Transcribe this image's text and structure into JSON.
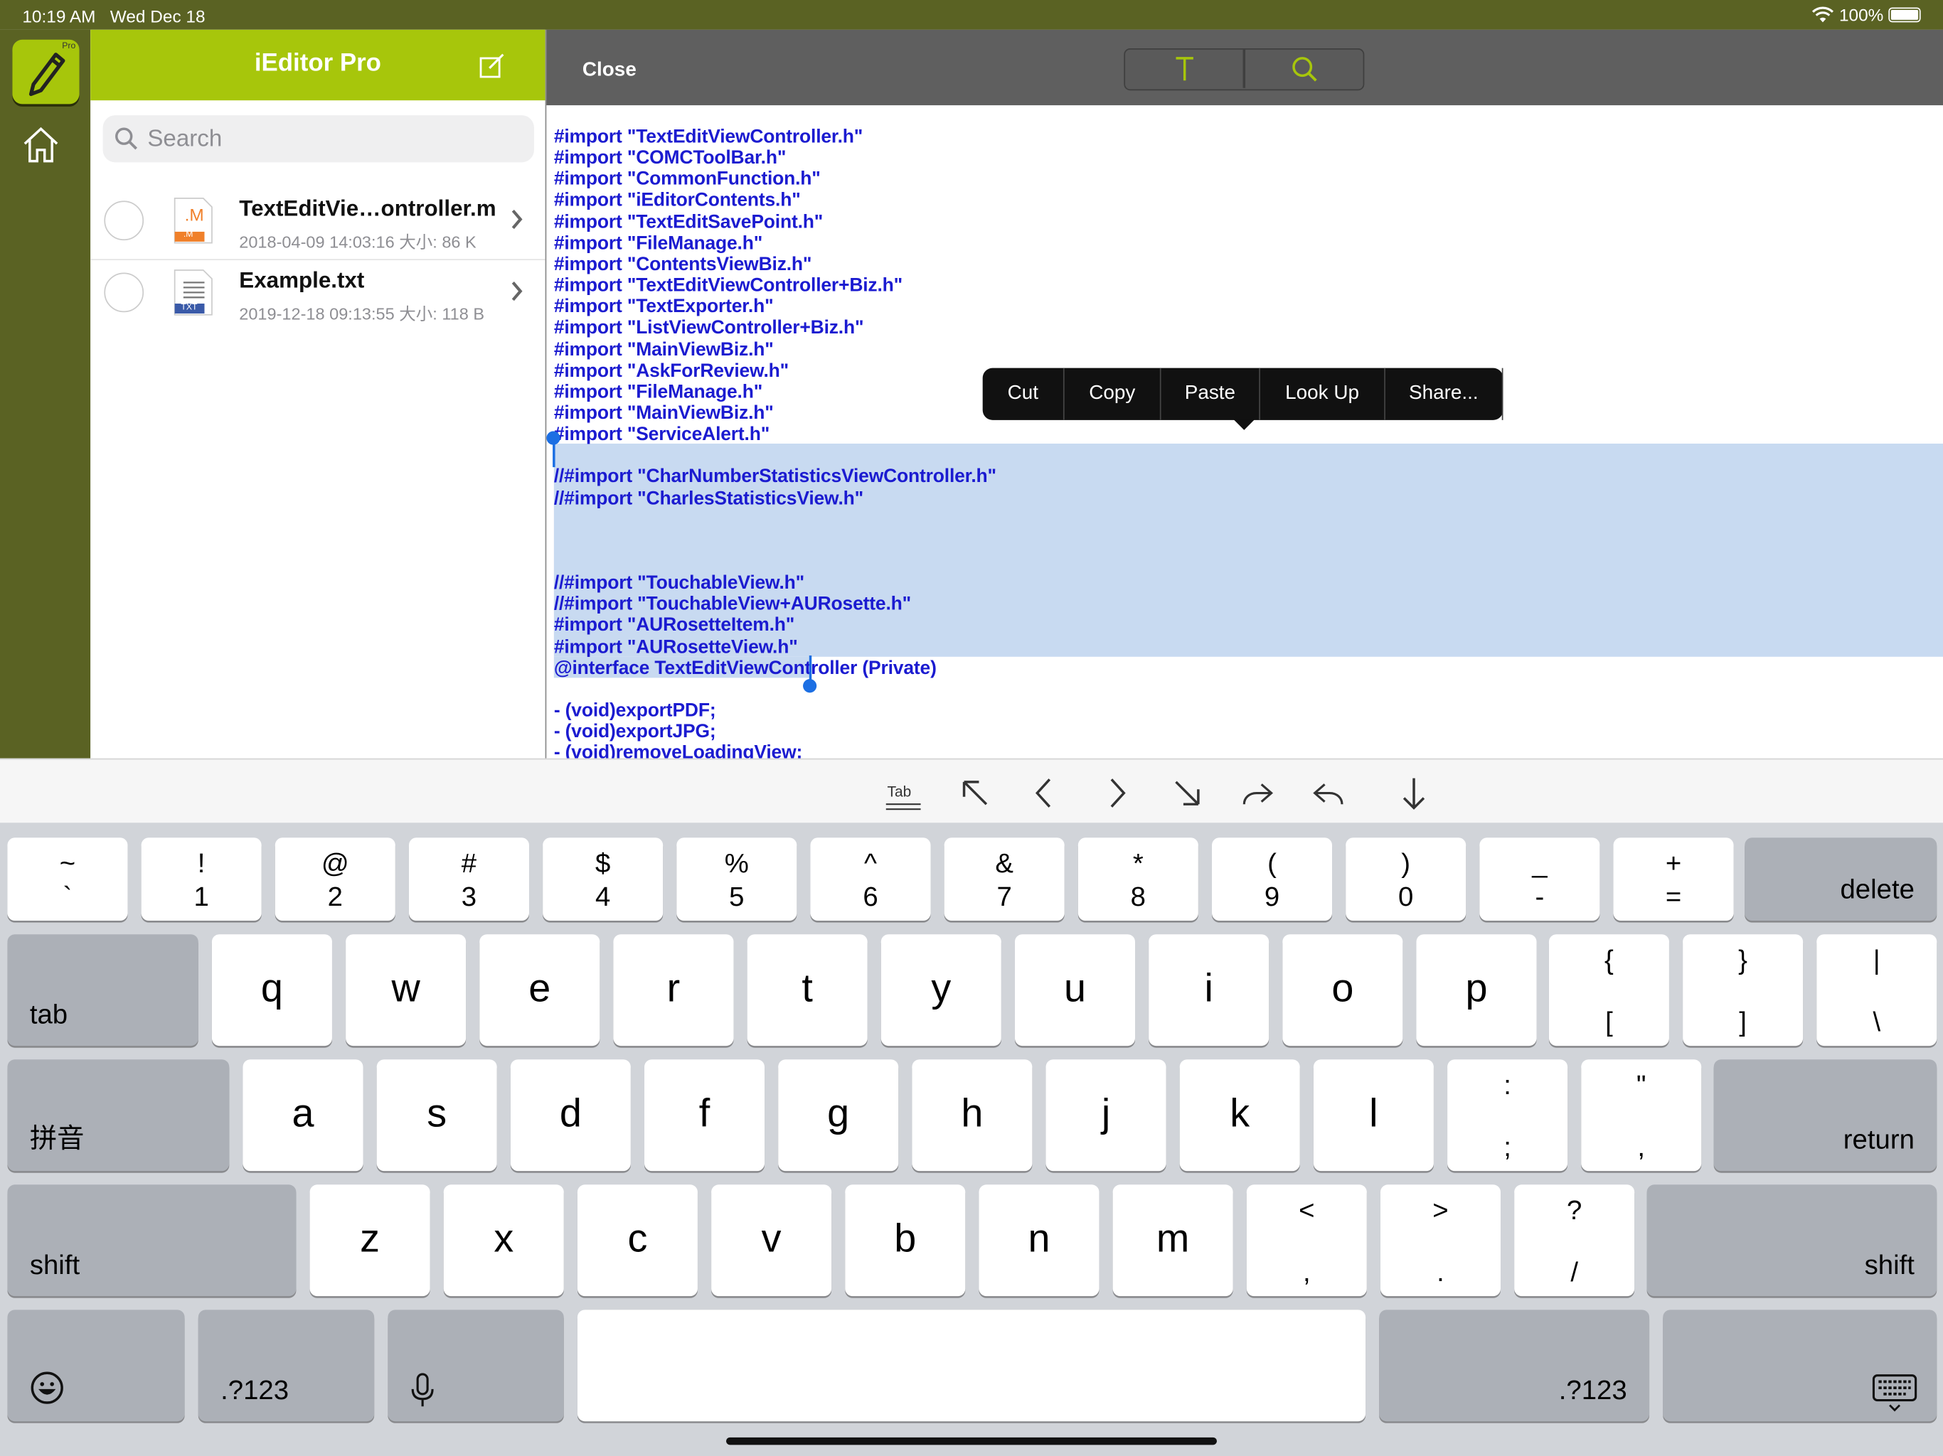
{
  "status": {
    "time": "10:19 AM",
    "date": "Wed Dec 18",
    "battery": "100%"
  },
  "sidebar": {
    "title": "iEditor Pro",
    "search_placeholder": "Search",
    "app_badge": "Pro"
  },
  "files": [
    {
      "name": "TextEditVie…ontroller.m",
      "meta": "2018-04-09 14:03:16  大小: 86 K",
      "icon_label": ".M",
      "icon_badge": ".M",
      "type_color": "#f0802a"
    },
    {
      "name": "Example.txt",
      "meta": "2019-12-18 09:13:55  大小: 118 B",
      "icon_label": "",
      "icon_badge": "TXT",
      "type_color": "#3a5aa8"
    }
  ],
  "editor": {
    "close_label": "Close",
    "lines": [
      "#import \"TextEditViewController.h\"",
      "#import \"COMCToolBar.h\"",
      "#import \"CommonFunction.h\"",
      "#import \"iEditorContents.h\"",
      "#import \"TextEditSavePoint.h\"",
      "#import \"FileManage.h\"",
      "#import \"ContentsViewBiz.h\"",
      "#import \"TextEditViewController+Biz.h\"",
      "#import \"TextExporter.h\"",
      "#import \"ListViewController+Biz.h\"",
      "#import \"MainViewBiz.h\"",
      "#import \"AskForReview.h\"",
      "#import \"FileManage.h\"",
      "#import \"MainViewBiz.h\"",
      "#import \"ServiceAlert.h\"",
      "",
      "//#import \"CharNumberStatisticsViewController.h\"",
      "//#import \"CharlesStatisticsView.h\"",
      "",
      "",
      "",
      "//#import \"TouchableView.h\"",
      "//#import \"TouchableView+AURosette.h\"",
      "#import \"AURosetteItem.h\"",
      "#import \"AURosetteView.h\"",
      "@interface TextEditViewController (Private)",
      "",
      "- (void)exportPDF;",
      "- (void)exportJPG;",
      "- (void)removeLoadingView;"
    ]
  },
  "context_menu": [
    "Cut",
    "Copy",
    "Paste",
    "Look Up",
    "Share..."
  ],
  "toolbar": {
    "tab_label": "Tab"
  },
  "keyboard": {
    "row1": [
      {
        "t": "~",
        "b": "`"
      },
      {
        "t": "!",
        "b": "1"
      },
      {
        "t": "@",
        "b": "2"
      },
      {
        "t": "#",
        "b": "3"
      },
      {
        "t": "$",
        "b": "4"
      },
      {
        "t": "%",
        "b": "5"
      },
      {
        "t": "^",
        "b": "6"
      },
      {
        "t": "&",
        "b": "7"
      },
      {
        "t": "*",
        "b": "8"
      },
      {
        "t": "(",
        "b": "9"
      },
      {
        "t": ")",
        "b": "0"
      },
      {
        "t": "_",
        "b": "-"
      },
      {
        "t": "+",
        "b": "="
      }
    ],
    "row2": [
      "q",
      "w",
      "e",
      "r",
      "t",
      "y",
      "u",
      "i",
      "o",
      "p"
    ],
    "row2_sym": [
      {
        "t": "{",
        "b": "["
      },
      {
        "t": "}",
        "b": "]"
      },
      {
        "t": "|",
        "b": "\\"
      }
    ],
    "row3": [
      "a",
      "s",
      "d",
      "f",
      "g",
      "h",
      "j",
      "k",
      "l"
    ],
    "row3_sym": [
      {
        "t": ":",
        "b": ";"
      },
      {
        "t": "\"",
        "b": ","
      }
    ],
    "row4": [
      "z",
      "x",
      "c",
      "v",
      "b",
      "n",
      "m"
    ],
    "row4_sym": [
      {
        "t": "<",
        "b": ","
      },
      {
        "t": ">",
        "b": "."
      },
      {
        "t": "?",
        "b": "/"
      }
    ],
    "delete": "delete",
    "tab": "tab",
    "pinyin": "拼音",
    "return": "return",
    "shift": "shift",
    "num": ".?123"
  },
  "colors": {
    "brand": "#a7c60b",
    "rail": "#5a6223",
    "code": "#1b1bd0",
    "selection": "#c8daf1"
  }
}
